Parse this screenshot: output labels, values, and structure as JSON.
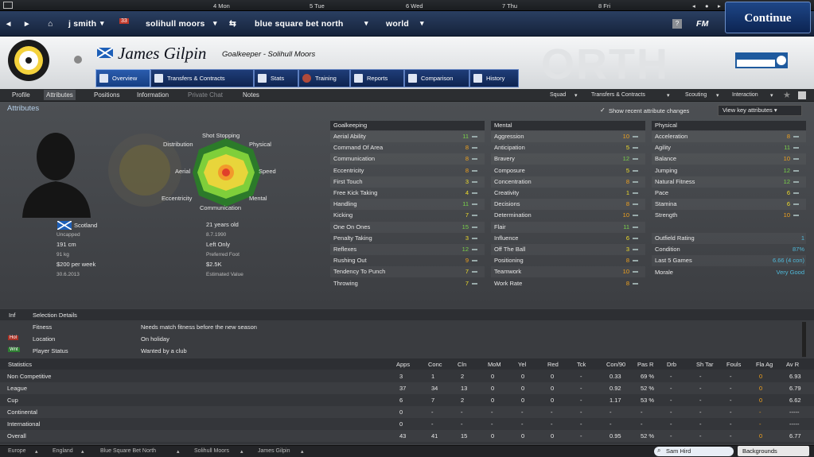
{
  "days": [
    "4 Mon",
    "5 Tue",
    "6 Wed",
    "7 Thu",
    "8 Fri"
  ],
  "nav": {
    "manager": "j smith",
    "inbox_count": "33",
    "club": "solihull moors",
    "competition": "blue square bet north",
    "world": "world",
    "fm": "FM",
    "continue": "Continue"
  },
  "player": {
    "name": "James Gilpin",
    "role": "Goalkeeper - Solihull Moors"
  },
  "tabs": [
    "Overview",
    "Transfers & Contracts",
    "Stats",
    "Training",
    "Reports",
    "Comparison",
    "History"
  ],
  "subtabs": [
    "Profile",
    "Attributes",
    "Positions",
    "Information",
    "Private Chat",
    "Notes"
  ],
  "subright": [
    "Squad",
    "Transfers & Contracts",
    "Scouting",
    "Interaction"
  ],
  "section_title": "Attributes",
  "show_recent": "Show recent attribute changes",
  "view_key": "View key attributes",
  "radar_labels": [
    "Shot Stopping",
    "Physical",
    "Speed",
    "Mental",
    "Communication",
    "Eccentricity",
    "Aerial",
    "Distribution"
  ],
  "bio": {
    "nation": "Scotland",
    "caps": "Uncapped",
    "height": "191 cm",
    "weight": "91 kg",
    "wage": "$200 per week",
    "contract": "30.6.2013",
    "age": "21 years old",
    "dob": "8.7.1990",
    "foot": "Left Only",
    "foot_label": "Preferred Foot",
    "value": "$2.5K",
    "value_label": "Estimated Value"
  },
  "gk_title": "Goalkeeping",
  "gk": [
    [
      "Aerial Ability",
      "11"
    ],
    [
      "Command Of Area",
      "8"
    ],
    [
      "Communication",
      "8"
    ],
    [
      "Eccentricity",
      "8"
    ],
    [
      "First Touch",
      "3"
    ],
    [
      "Free Kick Taking",
      "4"
    ],
    [
      "Handling",
      "11"
    ],
    [
      "Kicking",
      "7"
    ],
    [
      "One On Ones",
      "15"
    ],
    [
      "Penalty Taking",
      "3"
    ],
    [
      "Reflexes",
      "12"
    ],
    [
      "Rushing Out",
      "9"
    ],
    [
      "Tendency To Punch",
      "7"
    ],
    [
      "Throwing",
      "7"
    ]
  ],
  "mental_title": "Mental",
  "mental": [
    [
      "Aggression",
      "10"
    ],
    [
      "Anticipation",
      "5"
    ],
    [
      "Bravery",
      "12"
    ],
    [
      "Composure",
      "5"
    ],
    [
      "Concentration",
      "8"
    ],
    [
      "Creativity",
      "1"
    ],
    [
      "Decisions",
      "8"
    ],
    [
      "Determination",
      "10"
    ],
    [
      "Flair",
      "11"
    ],
    [
      "Influence",
      "6"
    ],
    [
      "Off The Ball",
      "3"
    ],
    [
      "Positioning",
      "8"
    ],
    [
      "Teamwork",
      "10"
    ],
    [
      "Work Rate",
      "8"
    ]
  ],
  "physical_title": "Physical",
  "physical": [
    [
      "Acceleration",
      "8"
    ],
    [
      "Agility",
      "11"
    ],
    [
      "Balance",
      "10"
    ],
    [
      "Jumping",
      "12"
    ],
    [
      "Natural Fitness",
      "12"
    ],
    [
      "Pace",
      "6"
    ],
    [
      "Stamina",
      "6"
    ],
    [
      "Strength",
      "10"
    ]
  ],
  "extra": [
    [
      "Outfield Rating",
      "1"
    ],
    [
      "Condition",
      "87%"
    ],
    [
      "Last 5 Games",
      "6.66 (4 con)"
    ],
    [
      "Morale",
      "Very Good"
    ]
  ],
  "info": {
    "h1": "Inf",
    "h2": "Selection Details",
    "rows": [
      [
        "",
        "Fitness",
        "Needs match fitness before the new season"
      ],
      [
        "Hol",
        "Location",
        "On holiday"
      ],
      [
        "Wnt",
        "Player Status",
        "Wanted by a club"
      ]
    ]
  },
  "stats": {
    "title": "Statistics",
    "cols": [
      "Apps",
      "Conc",
      "Cln",
      "MoM",
      "Yel",
      "Red",
      "Tck",
      "Con/90",
      "Pas R",
      "Drb",
      "Sh Tar",
      "Fouls",
      "Fla Ag",
      "Av R"
    ],
    "rows": [
      [
        "Non Competitive",
        "3",
        "1",
        "2",
        "0",
        "0",
        "0",
        "-",
        "0.33",
        "69 %",
        "-",
        "-",
        "-",
        "0",
        "6.93"
      ],
      [
        "League",
        "37",
        "34",
        "13",
        "0",
        "0",
        "0",
        "-",
        "0.92",
        "52 %",
        "-",
        "-",
        "-",
        "0",
        "6.79"
      ],
      [
        "Cup",
        "6",
        "7",
        "2",
        "0",
        "0",
        "0",
        "-",
        "1.17",
        "53 %",
        "-",
        "-",
        "-",
        "0",
        "6.62"
      ],
      [
        "Continental",
        "0",
        "-",
        "-",
        "-",
        "-",
        "-",
        "-",
        "-",
        "-",
        "-",
        "-",
        "-",
        "-",
        "-----"
      ],
      [
        "International",
        "0",
        "-",
        "-",
        "-",
        "-",
        "-",
        "-",
        "-",
        "-",
        "-",
        "-",
        "-",
        "-",
        "-----"
      ],
      [
        "Overall",
        "43",
        "41",
        "15",
        "0",
        "0",
        "0",
        "-",
        "0.95",
        "52 %",
        "-",
        "-",
        "-",
        "0",
        "6.77"
      ]
    ]
  },
  "crumbs": [
    "Europe",
    "England",
    "Blue Square Bet North",
    "Solihull Moors",
    "James Gilpin"
  ],
  "search": "Sam Hird",
  "backgrounds": "Backgrounds"
}
